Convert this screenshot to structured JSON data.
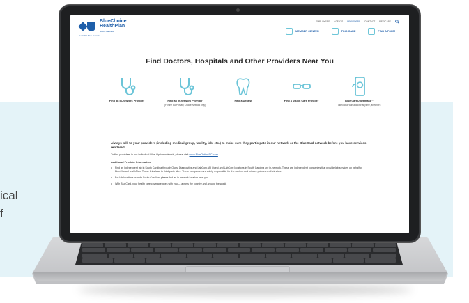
{
  "side_text": [
    "ical",
    "f"
  ],
  "site": {
    "logo_name_line1": "BlueChoice",
    "logo_name_line2": "HealthPlan",
    "logo_sub": "South Carolina",
    "tagline": "Go to SC Blue at work",
    "top_links": [
      "EMPLOYERS",
      "AGENTS",
      "PROVIDERS",
      "CONTACT",
      "MEDICARE"
    ],
    "active_top_link": "PROVIDERS",
    "main_nav": [
      "MEMBER CENTER",
      "FIND CARE",
      "FIND A FORM"
    ],
    "page_title": "Find Doctors, Hospitals and Other Providers Near You",
    "provider_cards": [
      {
        "icon": "stethoscope-icon",
        "label": "Find an In-network Provider",
        "sub": ""
      },
      {
        "icon": "stethoscope-icon",
        "label": "Find an In-network Provider",
        "sub": "(For the BA Primary Choice Network only)"
      },
      {
        "icon": "tooth-icon",
        "label": "Find a Dentist",
        "sub": ""
      },
      {
        "icon": "glasses-icon",
        "label": "Find a Vision Care Provider",
        "sub": ""
      },
      {
        "icon": "phone-video-icon",
        "label": "Blue CareOnDemand℠",
        "sub": "Video chat with a doctor anytime, anywhere."
      }
    ],
    "notice": "Always talk to your providers (including medical group, facility, lab, etc.) to make sure they participate in our network or the BlueCard network before you have services rendered.",
    "individual_text": "To find providers in our individual Blue Option network, please visit",
    "individual_link": "www.BlueOptionSC.com",
    "additional_heading": "Additional Provider Information:",
    "bullets": [
      "Find an independent lab in South Carolina through Quest Diagnostics and LabCorp. All Quest and LabCorp locations in South Carolina are in-network. These are independent companies that provide lab services on behalf of BlueChoice HealthPlan. These links lead to third party sites. These companies are solely responsible for the content and privacy policies on their sites.",
      "For lab locations outside South Carolina, please find an in-network location near you.",
      "With BlueCard, your health care coverage goes with you — across the country and around the world."
    ]
  }
}
